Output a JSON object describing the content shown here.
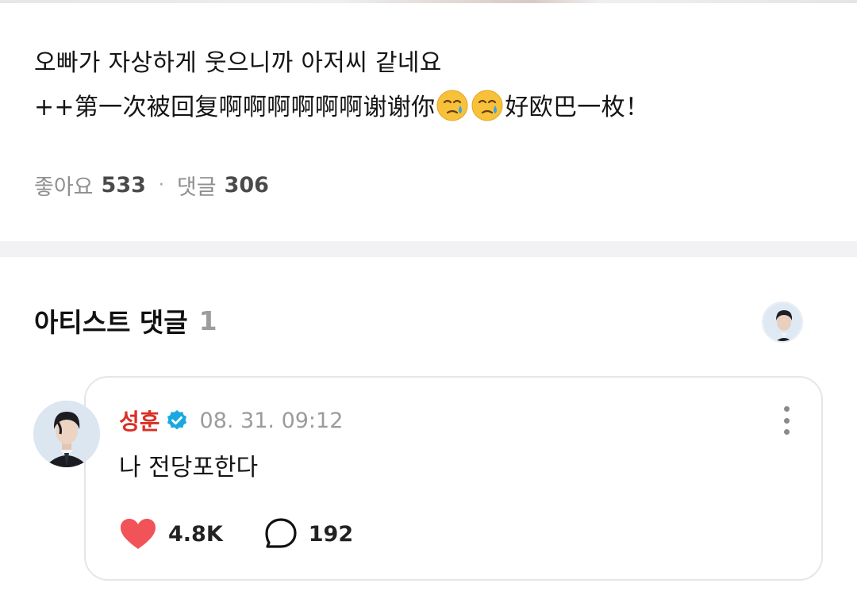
{
  "post": {
    "line1": "오빠가 자상하게 웃으니까 아저씨 같네요",
    "line2_a": "++第一次被回复啊啊啊啊啊啊谢谢你",
    "line2_b": "好欧巴一枚！",
    "emoji": "crying-face-emoji",
    "likes_label": "좋아요",
    "likes_count": "533",
    "dot": "·",
    "comments_label": "댓글",
    "comments_count": "306"
  },
  "artist_comments": {
    "title": "아티스트 댓글",
    "count": "1"
  },
  "comment": {
    "author": "성훈",
    "date": "08. 31. 09:12",
    "text": "나 전당포한다",
    "likes": "4.8K",
    "replies": "192"
  },
  "colors": {
    "author": "#d93025",
    "verified": "#1aa8e0",
    "heart": "#f25358",
    "divider": "#f2f2f4"
  }
}
